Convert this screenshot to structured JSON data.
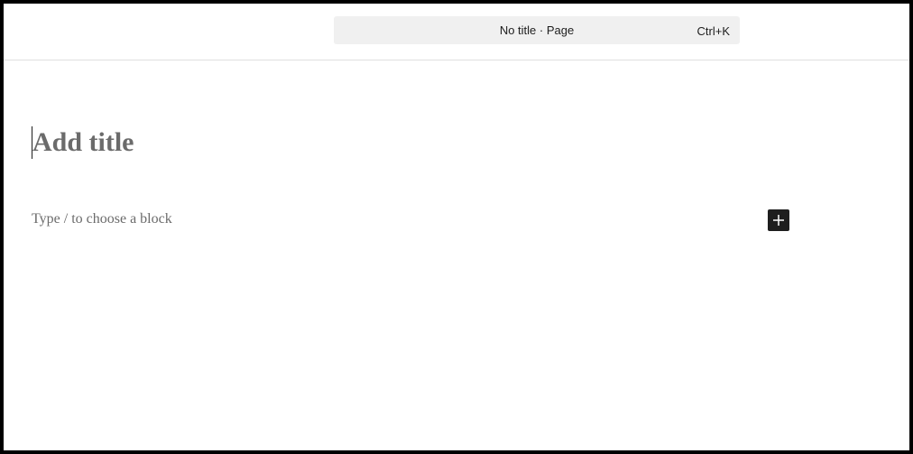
{
  "header": {
    "document_title": "No title · Page",
    "shortcut": "Ctrl+K"
  },
  "editor": {
    "title_placeholder": "Add title",
    "block_placeholder": "Type / to choose a block",
    "add_block_icon": "plus-icon"
  },
  "colors": {
    "command_bar_bg": "#f0f0f0",
    "placeholder_text": "#6b6b6b",
    "add_button_bg": "#1e1e1e"
  }
}
